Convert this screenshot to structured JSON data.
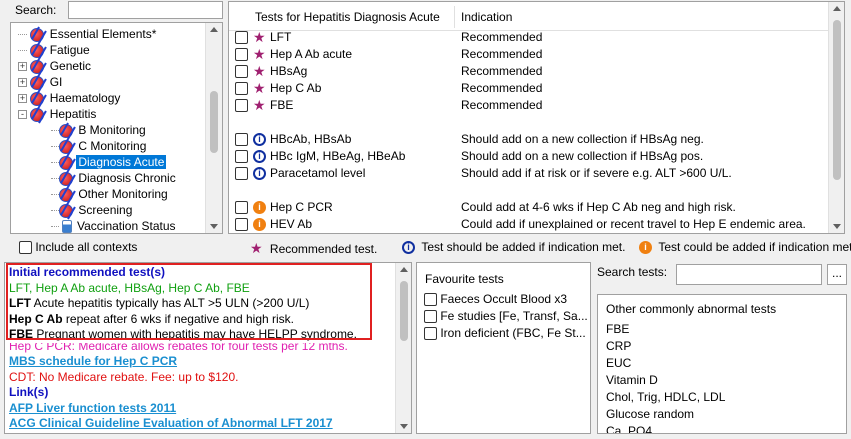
{
  "search": {
    "label": "Search:",
    "value": ""
  },
  "tree": {
    "items": [
      {
        "label": "Essential Elements*",
        "expander": "",
        "indent": 0
      },
      {
        "label": "Fatigue",
        "expander": "",
        "indent": 0
      },
      {
        "label": "Genetic",
        "expander": "+",
        "indent": 0
      },
      {
        "label": "GI",
        "expander": "+",
        "indent": 0
      },
      {
        "label": "Haematology",
        "expander": "+",
        "indent": 0
      },
      {
        "label": "Hepatitis",
        "expander": "-",
        "indent": 0
      },
      {
        "label": "B Monitoring",
        "expander": "",
        "indent": 1
      },
      {
        "label": "C Monitoring",
        "expander": "",
        "indent": 1
      },
      {
        "label": "Diagnosis Acute",
        "expander": "",
        "indent": 1,
        "selected": true
      },
      {
        "label": "Diagnosis Chronic",
        "expander": "",
        "indent": 1
      },
      {
        "label": "Other Monitoring",
        "expander": "",
        "indent": 1
      },
      {
        "label": "Screening",
        "expander": "",
        "indent": 1
      },
      {
        "label": "Vaccination Status",
        "expander": "",
        "indent": 1,
        "icon": "vaccine-icon"
      }
    ]
  },
  "tests_table": {
    "header_tests": "Tests for  Hepatitis Diagnosis Acute",
    "header_indication": "Indication",
    "rows": [
      {
        "name": "LFT",
        "indication": "Recommended",
        "icon": "star-icon"
      },
      {
        "name": "Hep A Ab acute",
        "indication": "Recommended",
        "icon": "star-icon"
      },
      {
        "name": "HBsAg",
        "indication": "Recommended",
        "icon": "star-icon"
      },
      {
        "name": "Hep C Ab",
        "indication": "Recommended",
        "icon": "star-icon"
      },
      {
        "name": "FBE",
        "indication": "Recommended",
        "icon": "star-icon"
      },
      {
        "name": "HBcAb, HBsAb",
        "indication": "Should add on a new collection if HBsAg neg.",
        "icon": "info-blue-icon"
      },
      {
        "name": "HBc IgM, HBeAg, HBeAb",
        "indication": "Should add on a new collection if HBsAg pos.",
        "icon": "info-blue-icon"
      },
      {
        "name": "Paracetamol level",
        "indication": "Should add if at risk or if severe e.g. ALT >600 U/L.",
        "icon": "info-blue-icon"
      },
      {
        "name": "Hep C PCR",
        "indication": "Could add at 4-6 wks if Hep C Ab neg and high risk.",
        "icon": "info-orange-icon"
      },
      {
        "name": "HEV Ab",
        "indication": "Could add if unexplained or recent travel to Hep E endemic area.",
        "icon": "info-orange-icon"
      }
    ]
  },
  "include_all_contexts": "Include all contexts",
  "legend": {
    "recommended": "Recommended test.",
    "should": "Test should be added if indication met.",
    "could": "Test could be added if indication met."
  },
  "notes": {
    "title": "Initial recommended test(s)",
    "tests_line": "LFT, Hep A Ab acute, HBsAg, Hep C Ab, FBE",
    "line1_bold": "LFT",
    "line1_text": " Acute hepatitis typically has ALT >5 ULN (>200 U/L)",
    "line2_bold": "Hep C Ab",
    "line2_text": " repeat after 6 wks if negative and high risk.",
    "line3_bold": "FBE",
    "line3_text": " Pregnant women with hepatitis may have HELPP syndrome.",
    "hidden_line": "Hep C PCR: Medicare allows rebates for four tests per 12 mths.",
    "mbs_link": "MBS schedule for Hep C PCR",
    "cdt_line": "CDT: No Medicare rebate. Fee: up to $120.",
    "links_title": "Link(s)",
    "link1": "AFP Liver function tests 2011",
    "link2": "ACG Clinical Guideline Evaluation of Abnormal LFT 2017"
  },
  "favourites": {
    "title": "Favourite tests",
    "items": [
      "Faeces Occult Blood x3",
      "Fe studies [Fe, Transf, Sa...",
      "Iron deficient (FBC, Fe St..."
    ]
  },
  "search_tests": {
    "label": "Search tests:",
    "value": "",
    "button": "..."
  },
  "other_tests": {
    "title": "Other commonly abnormal tests",
    "items": [
      "FBE",
      "CRP",
      "EUC",
      "Vitamin D",
      "Chol, Trig, HDLC, LDL",
      "Glucose random",
      "Ca, PO4"
    ]
  },
  "colors": {
    "highlight_border": "#e02020",
    "selected_bg": "#0078d7"
  }
}
